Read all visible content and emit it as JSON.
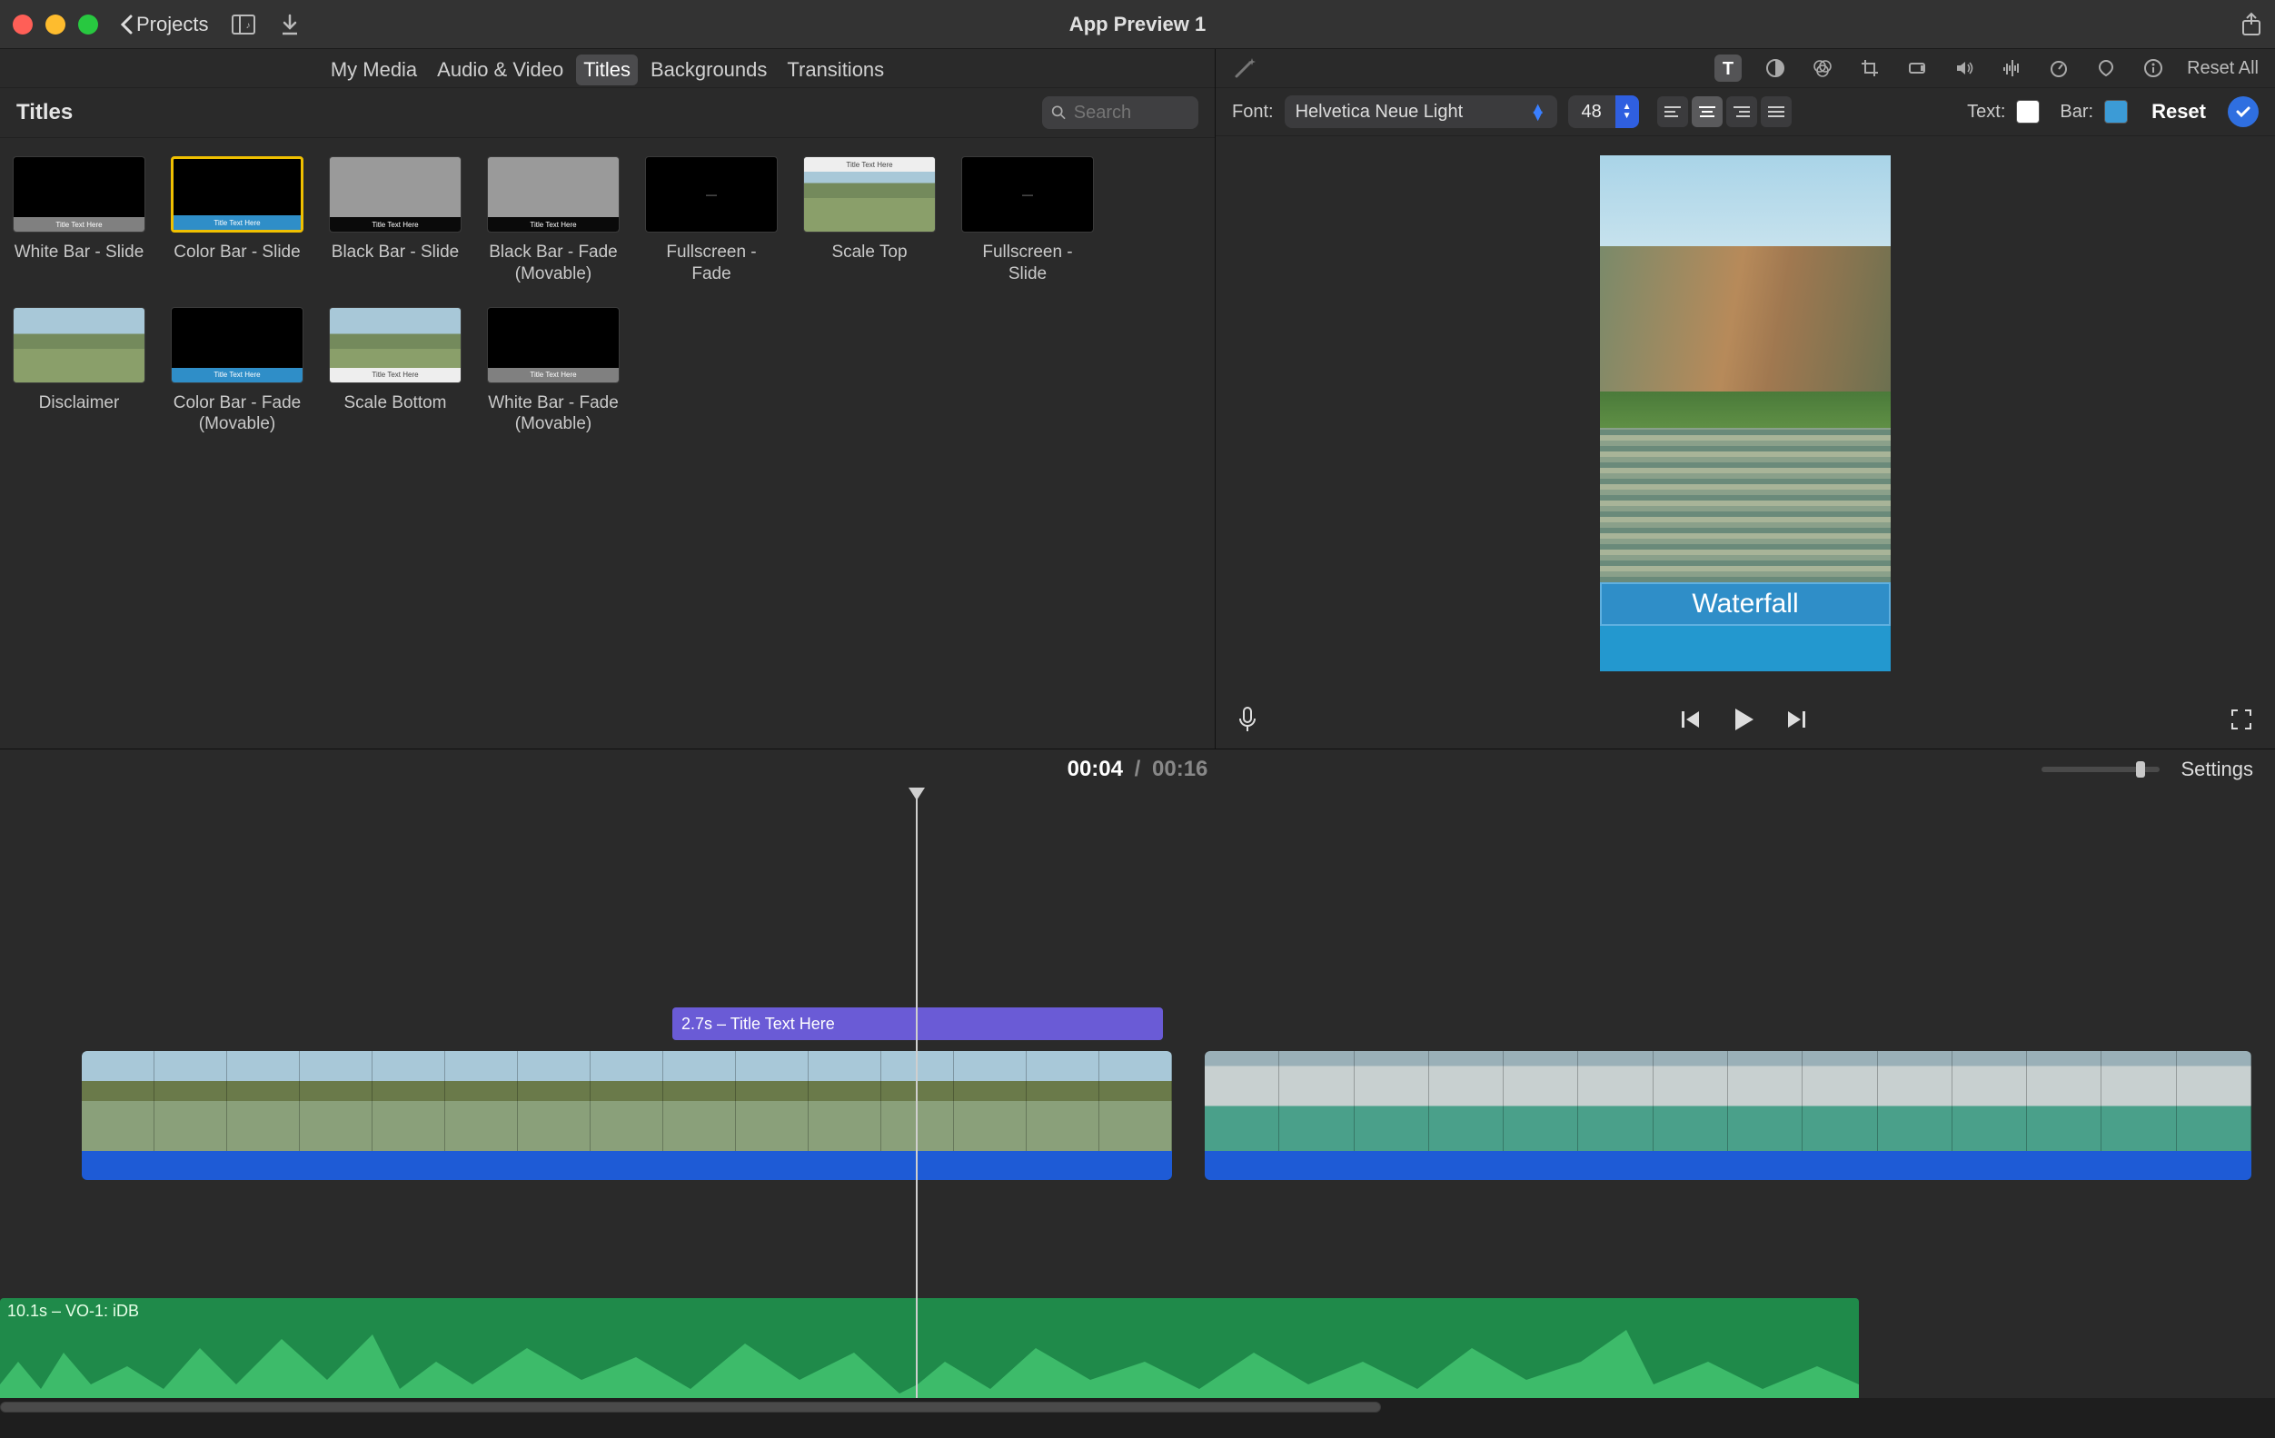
{
  "titlebar": {
    "back_label": "Projects",
    "app_title": "App Preview 1"
  },
  "media_tabs": [
    "My Media",
    "Audio & Video",
    "Titles",
    "Backgrounds",
    "Transitions"
  ],
  "media_tab_active": 2,
  "titles_panel": {
    "heading": "Titles",
    "search_placeholder": "Search"
  },
  "titles": [
    {
      "name": "White Bar - Slide",
      "thumb": "black",
      "bar": "gray",
      "pos": "bottom"
    },
    {
      "name": "Color Bar - Slide",
      "thumb": "black",
      "bar": "blue",
      "pos": "bottom",
      "selected": true
    },
    {
      "name": "Black Bar - Slide",
      "thumb": "gray",
      "bar": "black",
      "pos": "bottom"
    },
    {
      "name": "Black Bar - Fade (Movable)",
      "thumb": "gray",
      "bar": "black",
      "pos": "bottom"
    },
    {
      "name": "Fullscreen - Fade",
      "thumb": "black",
      "center": "—"
    },
    {
      "name": "Scale Top",
      "thumb": "image",
      "bar": "white",
      "pos": "top"
    },
    {
      "name": "Fullscreen - Slide",
      "thumb": "black",
      "center": "—"
    },
    {
      "name": "Disclaimer",
      "thumb": "image"
    },
    {
      "name": "Color Bar - Fade (Movable)",
      "thumb": "black",
      "bar": "blue",
      "pos": "bottom"
    },
    {
      "name": "Scale Bottom",
      "thumb": "image",
      "bar": "white",
      "pos": "bottom"
    },
    {
      "name": "White Bar - Fade (Movable)",
      "thumb": "black",
      "bar": "gray",
      "pos": "bottom"
    }
  ],
  "inspector": {
    "reset_all": "Reset All",
    "font_label": "Font:",
    "font_value": "Helvetica Neue Light",
    "size_value": "48",
    "text_label": "Text:",
    "bar_label": "Bar:",
    "text_color": "#ffffff",
    "bar_color": "#3c9bd6",
    "reset_btn": "Reset"
  },
  "preview": {
    "title_text": "Waterfall"
  },
  "timeline": {
    "current": "00:04",
    "duration": "00:16",
    "settings": "Settings",
    "title_clip_label": "2.7s – Title Text Here",
    "voiceover_label": "10.1s – VO-1: iDB"
  }
}
